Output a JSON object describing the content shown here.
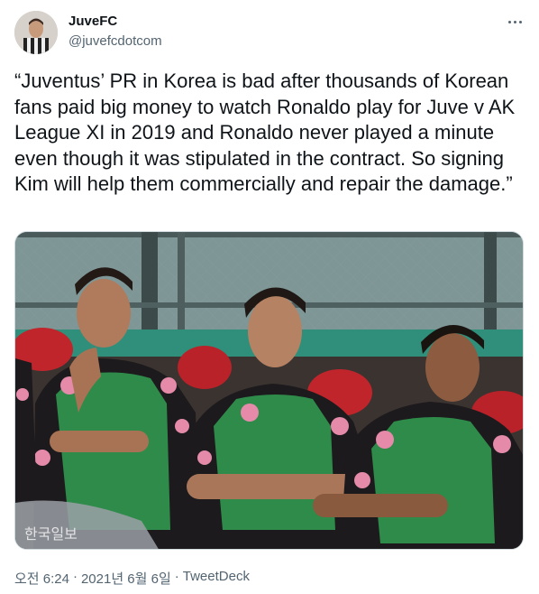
{
  "tweet": {
    "display_name": "JuveFC",
    "handle": "@juvefcdotcom",
    "text": "“Juventus’ PR in Korea is bad after thousands of Korean fans paid big money to watch Ronaldo play for Juve v AK League XI in 2019 and Ronaldo never played a minute even though it was stipulated in the contract. So signing Kim will help them commercially and repair the damage.”",
    "time": "오전 6:24",
    "date": "2021년 6월 6일",
    "separator": "·",
    "source": "TweetDeck",
    "more_icon": "more-horizontal-icon"
  },
  "photo": {
    "watermark": "한국일보"
  },
  "colors": {
    "text_primary": "#0f1419",
    "text_secondary": "#536471",
    "border": "#cfd9de",
    "bib_green": "#2e8b4a",
    "seat_red": "#c0252c"
  }
}
